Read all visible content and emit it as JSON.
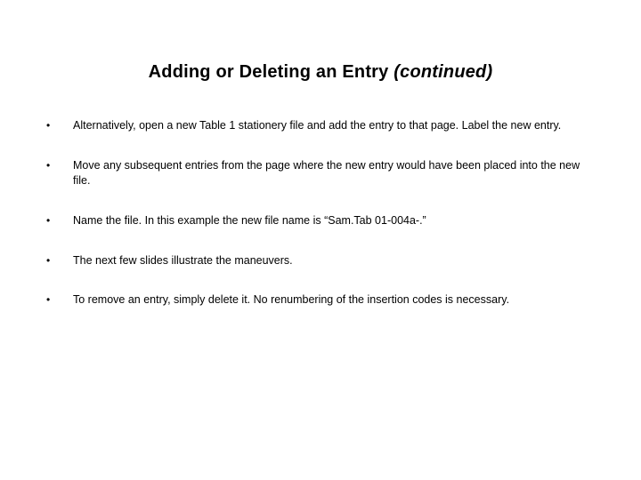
{
  "title": {
    "main": "Adding or Deleting an Entry ",
    "continued": "(continued)"
  },
  "bullets": [
    "Alternatively, open a new Table 1 stationery file and add the entry to that page. Label the new entry.",
    "Move any subsequent entries from the page where the new entry would have been placed into the new file.",
    "Name the file. In this example the new file name is “Sam.Tab 01-004a-.”",
    "The next few slides illustrate the maneuvers.",
    "To remove an entry, simply delete it. No renumbering of the insertion codes is necessary."
  ]
}
